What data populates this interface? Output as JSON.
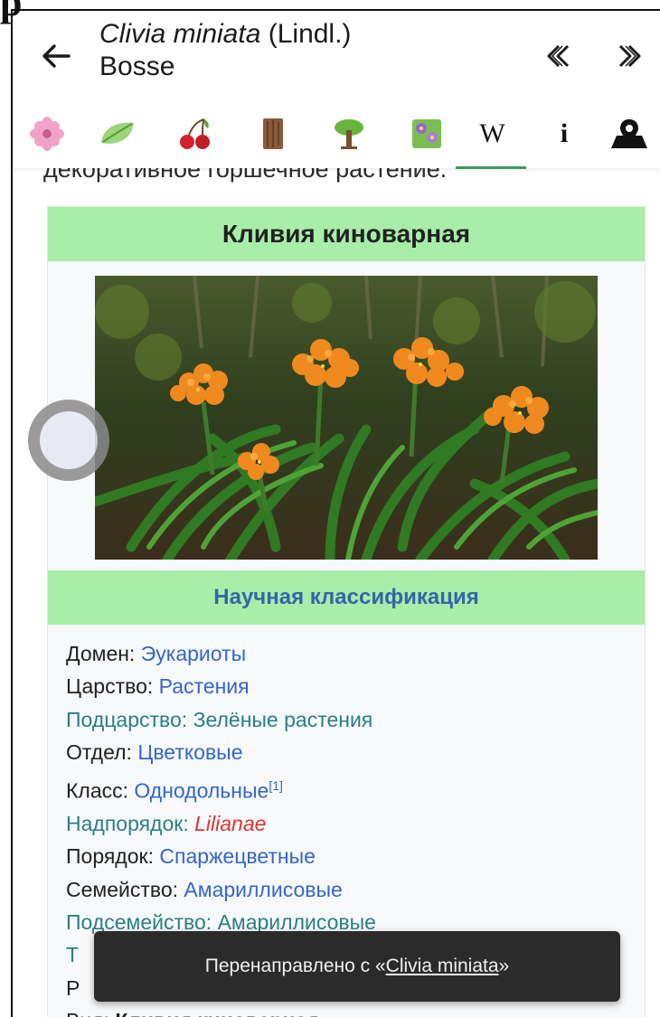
{
  "header": {
    "top_glyph": "p",
    "title_scientific": "Clivia miniata",
    "title_authority": " (Lindl.)",
    "title_author": "Bosse"
  },
  "tabs": [
    {
      "name": "flower-tab",
      "icon": "flower-icon"
    },
    {
      "name": "leaf-tab",
      "icon": "leaf-icon"
    },
    {
      "name": "fruit-tab",
      "icon": "cherry-icon"
    },
    {
      "name": "bark-tab",
      "icon": "bark-icon"
    },
    {
      "name": "habit-tab",
      "icon": "tree-icon"
    },
    {
      "name": "gallery-tab",
      "icon": "plant-icon"
    },
    {
      "name": "wikipedia-tab",
      "label": "W",
      "icon": "wikipedia-icon"
    },
    {
      "name": "info-tab",
      "label": "i",
      "icon": "info-icon"
    },
    {
      "name": "map-tab",
      "icon": "map-pin-icon"
    }
  ],
  "content": {
    "cut_text": "декоративное горшечное растение."
  },
  "infobox": {
    "title": "Кливия киноварная",
    "classification_title": "Научная классификация",
    "taxa": [
      {
        "rank": "Домен:",
        "value": "Эукариоты"
      },
      {
        "rank": "Царство:",
        "value": "Растения"
      },
      {
        "rank": "Подцарство:",
        "value": "Зелёные растения"
      },
      {
        "rank": "Отдел:",
        "value": "Цветковые"
      },
      {
        "rank": "Класс:",
        "value": "Однодольные",
        "ref": "[1]"
      },
      {
        "rank": "Надпорядок:",
        "value": "Lilianae"
      },
      {
        "rank": "Порядок:",
        "value": "Спаржецветные"
      },
      {
        "rank": "Семейство:",
        "value": "Амариллисовые"
      },
      {
        "rank": "Подсемейство:",
        "value": "Амариллисовые"
      },
      {
        "rank": "Т",
        "value": ""
      },
      {
        "rank": "Р",
        "value": ""
      },
      {
        "rank": "Вид:",
        "value": "Кливия киноварная"
      }
    ]
  },
  "toast": {
    "prefix": "Перенаправлено с «",
    "link": "Clivia miniata",
    "suffix": "»"
  },
  "colors": {
    "header_green": "#a8eea8",
    "link_blue": "#3366cc",
    "teal": "#2a7f84",
    "red_link": "#dd3333"
  }
}
